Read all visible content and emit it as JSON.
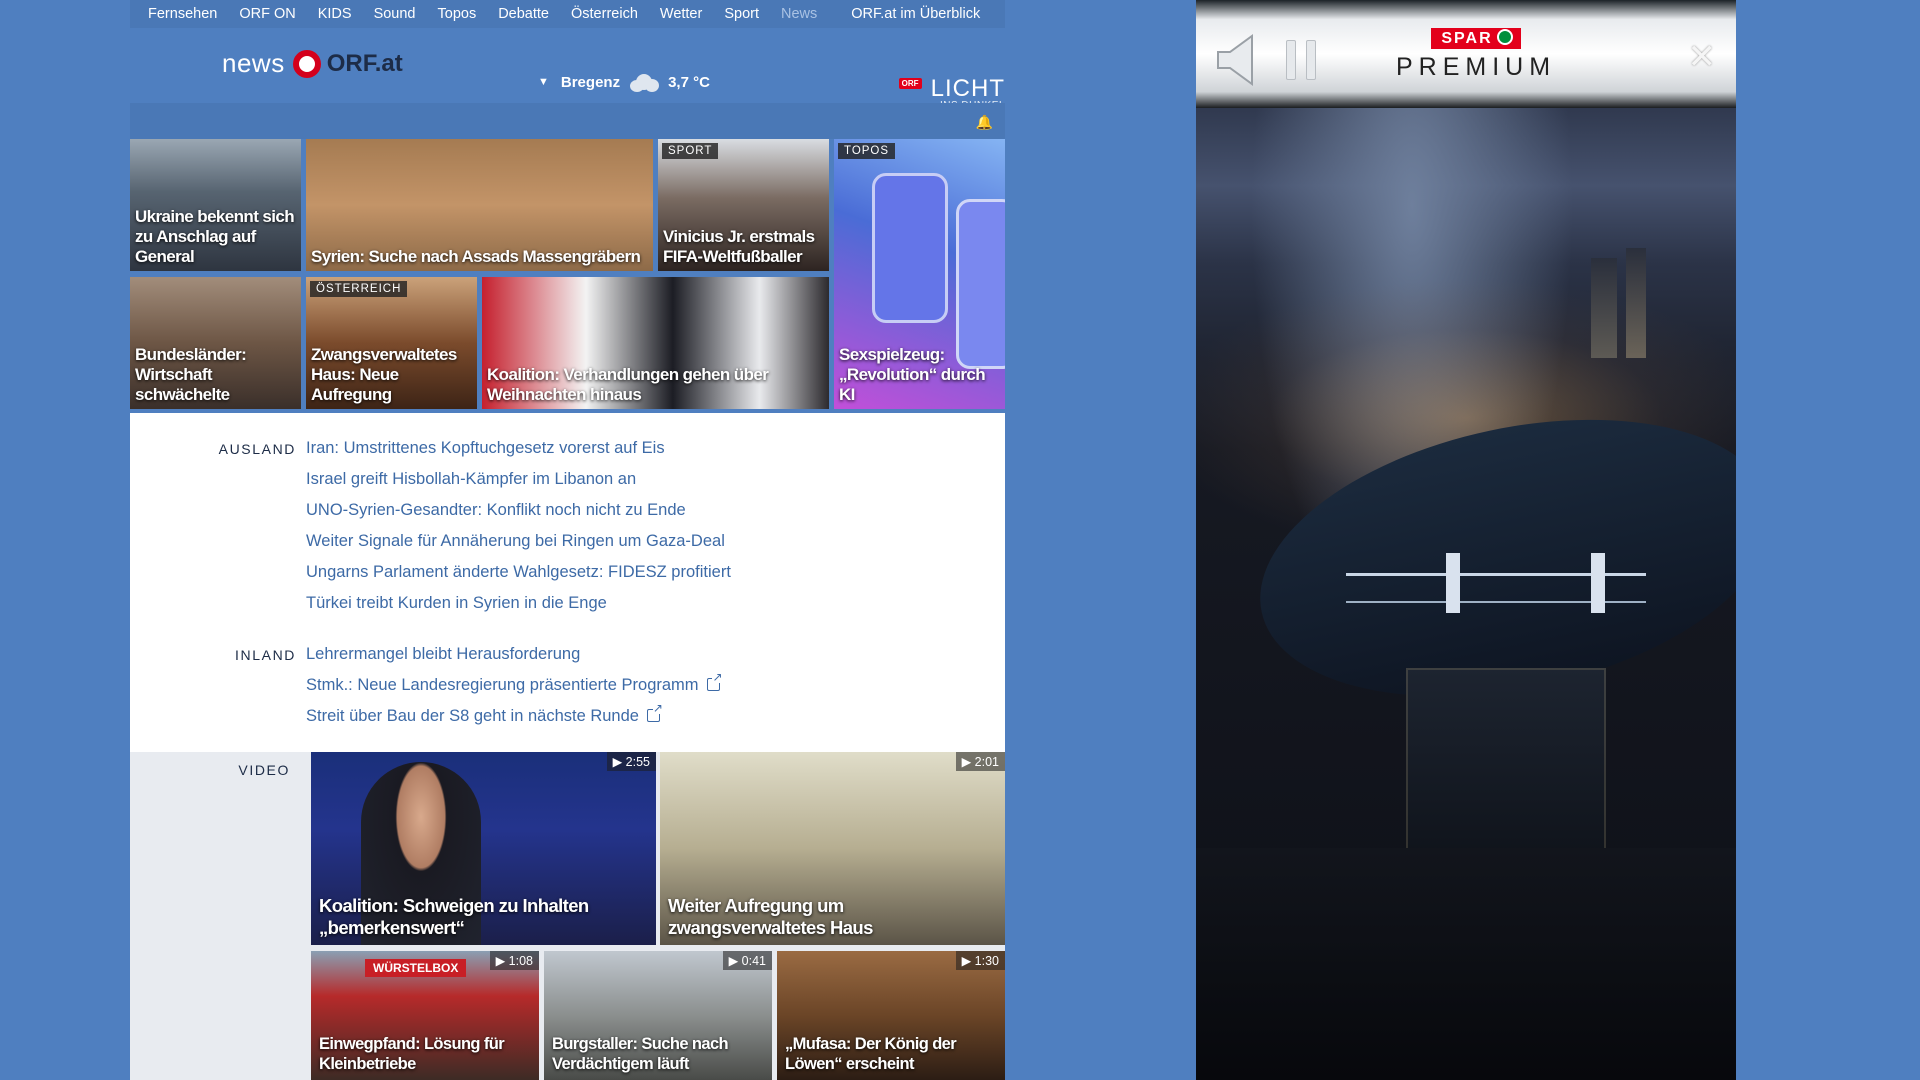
{
  "topnav": {
    "items": [
      "Fernsehen",
      "ORF ON",
      "KIDS",
      "Sound",
      "Topos",
      "Debatte",
      "Österreich",
      "Wetter",
      "Sport",
      "News"
    ],
    "overview": "ORF.at im Überblick"
  },
  "header": {
    "logo_news": "news",
    "logo_orf": "ORF.at",
    "weather": {
      "location": "Bregenz",
      "temperature": "3,7 °C"
    },
    "promo": {
      "badge": "ORF",
      "line1": "LICHT",
      "line2": "INS DUNKEL"
    }
  },
  "tiles": [
    {
      "caption": "Ukraine bekennt sich zu Anschlag auf General",
      "badge": ""
    },
    {
      "caption": "Syrien: Suche nach Assads Massengräbern",
      "badge": ""
    },
    {
      "caption": "Vinicius Jr. erstmals FIFA-Weltfußballer",
      "badge": "SPORT"
    },
    {
      "caption": "Sexspielzeug: „Revolution“ durch KI",
      "badge": "TOPOS"
    },
    {
      "caption": "Bundesländer: Wirtschaft schwächelte",
      "badge": ""
    },
    {
      "caption": "Zwangsverwaltetes Haus: Neue Aufregung",
      "badge": "ÖSTERREICH"
    },
    {
      "caption": "Koalition: Verhandlungen gehen über Weihnachten hinaus",
      "badge": ""
    }
  ],
  "ausland": {
    "label": "AUSLAND",
    "links": [
      "Iran: Umstrittenes Kopftuchgesetz vorerst auf Eis",
      "Israel greift Hisbollah-Kämpfer im Libanon an",
      "UNO-Syrien-Gesandter: Konflikt noch nicht zu Ende",
      "Weiter Signale für Annäherung bei Ringen um Gaza-Deal",
      "Ungarns Parlament änderte Wahlgesetz: FIDESZ profitiert",
      "Türkei treibt Kurden in Syrien in die Enge"
    ]
  },
  "inland": {
    "label": "INLAND",
    "links": [
      "Lehrermangel bleibt Herausforderung",
      "Stmk.: Neue Landesregierung präsentierte Programm",
      "Streit über Bau der S8 geht in nächste Runde"
    ]
  },
  "video": {
    "label": "VIDEO",
    "items": [
      {
        "caption": "Koalition: Schweigen zu Inhalten „bemerkenswert“",
        "duration": "2:55"
      },
      {
        "caption": "Weiter Aufregung um zwangsverwaltetes Haus",
        "duration": "2:01"
      },
      {
        "caption": "Einwegpfand: Lösung für Kleinbetriebe",
        "duration": "1:08",
        "sign": "WÜRSTELBOX"
      },
      {
        "caption": "Burgstaller: Suche nach Verdächtigem läuft",
        "duration": "0:41"
      },
      {
        "caption": "„Mufasa: Der König der Löwen“ erscheint",
        "duration": "1:30"
      }
    ]
  },
  "ad": {
    "brand": "SPAR",
    "title": "PREMIUM",
    "close": "✕"
  }
}
